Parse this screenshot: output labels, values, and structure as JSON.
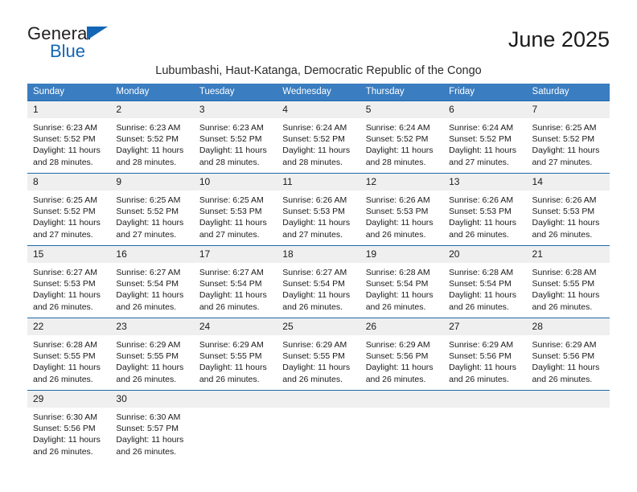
{
  "brand": {
    "name_top": "General",
    "name_bottom": "Blue",
    "accent_color": "#1266b5",
    "triangle_icon": "brand-triangle-icon"
  },
  "header": {
    "month_title": "June 2025",
    "subtitle": "Lubumbashi, Haut-Katanga, Democratic Republic of the Congo"
  },
  "calendar": {
    "header_bg": "#3a7dc0",
    "row_border": "#1f69ad",
    "daynum_bg": "#efefef",
    "weekdays": [
      "Sunday",
      "Monday",
      "Tuesday",
      "Wednesday",
      "Thursday",
      "Friday",
      "Saturday"
    ],
    "weeks": [
      [
        {
          "day": "1",
          "sunrise": "Sunrise: 6:23 AM",
          "sunset": "Sunset: 5:52 PM",
          "daylight_1": "Daylight: 11 hours",
          "daylight_2": "and 28 minutes."
        },
        {
          "day": "2",
          "sunrise": "Sunrise: 6:23 AM",
          "sunset": "Sunset: 5:52 PM",
          "daylight_1": "Daylight: 11 hours",
          "daylight_2": "and 28 minutes."
        },
        {
          "day": "3",
          "sunrise": "Sunrise: 6:23 AM",
          "sunset": "Sunset: 5:52 PM",
          "daylight_1": "Daylight: 11 hours",
          "daylight_2": "and 28 minutes."
        },
        {
          "day": "4",
          "sunrise": "Sunrise: 6:24 AM",
          "sunset": "Sunset: 5:52 PM",
          "daylight_1": "Daylight: 11 hours",
          "daylight_2": "and 28 minutes."
        },
        {
          "day": "5",
          "sunrise": "Sunrise: 6:24 AM",
          "sunset": "Sunset: 5:52 PM",
          "daylight_1": "Daylight: 11 hours",
          "daylight_2": "and 28 minutes."
        },
        {
          "day": "6",
          "sunrise": "Sunrise: 6:24 AM",
          "sunset": "Sunset: 5:52 PM",
          "daylight_1": "Daylight: 11 hours",
          "daylight_2": "and 27 minutes."
        },
        {
          "day": "7",
          "sunrise": "Sunrise: 6:25 AM",
          "sunset": "Sunset: 5:52 PM",
          "daylight_1": "Daylight: 11 hours",
          "daylight_2": "and 27 minutes."
        }
      ],
      [
        {
          "day": "8",
          "sunrise": "Sunrise: 6:25 AM",
          "sunset": "Sunset: 5:52 PM",
          "daylight_1": "Daylight: 11 hours",
          "daylight_2": "and 27 minutes."
        },
        {
          "day": "9",
          "sunrise": "Sunrise: 6:25 AM",
          "sunset": "Sunset: 5:52 PM",
          "daylight_1": "Daylight: 11 hours",
          "daylight_2": "and 27 minutes."
        },
        {
          "day": "10",
          "sunrise": "Sunrise: 6:25 AM",
          "sunset": "Sunset: 5:53 PM",
          "daylight_1": "Daylight: 11 hours",
          "daylight_2": "and 27 minutes."
        },
        {
          "day": "11",
          "sunrise": "Sunrise: 6:26 AM",
          "sunset": "Sunset: 5:53 PM",
          "daylight_1": "Daylight: 11 hours",
          "daylight_2": "and 27 minutes."
        },
        {
          "day": "12",
          "sunrise": "Sunrise: 6:26 AM",
          "sunset": "Sunset: 5:53 PM",
          "daylight_1": "Daylight: 11 hours",
          "daylight_2": "and 26 minutes."
        },
        {
          "day": "13",
          "sunrise": "Sunrise: 6:26 AM",
          "sunset": "Sunset: 5:53 PM",
          "daylight_1": "Daylight: 11 hours",
          "daylight_2": "and 26 minutes."
        },
        {
          "day": "14",
          "sunrise": "Sunrise: 6:26 AM",
          "sunset": "Sunset: 5:53 PM",
          "daylight_1": "Daylight: 11 hours",
          "daylight_2": "and 26 minutes."
        }
      ],
      [
        {
          "day": "15",
          "sunrise": "Sunrise: 6:27 AM",
          "sunset": "Sunset: 5:53 PM",
          "daylight_1": "Daylight: 11 hours",
          "daylight_2": "and 26 minutes."
        },
        {
          "day": "16",
          "sunrise": "Sunrise: 6:27 AM",
          "sunset": "Sunset: 5:54 PM",
          "daylight_1": "Daylight: 11 hours",
          "daylight_2": "and 26 minutes."
        },
        {
          "day": "17",
          "sunrise": "Sunrise: 6:27 AM",
          "sunset": "Sunset: 5:54 PM",
          "daylight_1": "Daylight: 11 hours",
          "daylight_2": "and 26 minutes."
        },
        {
          "day": "18",
          "sunrise": "Sunrise: 6:27 AM",
          "sunset": "Sunset: 5:54 PM",
          "daylight_1": "Daylight: 11 hours",
          "daylight_2": "and 26 minutes."
        },
        {
          "day": "19",
          "sunrise": "Sunrise: 6:28 AM",
          "sunset": "Sunset: 5:54 PM",
          "daylight_1": "Daylight: 11 hours",
          "daylight_2": "and 26 minutes."
        },
        {
          "day": "20",
          "sunrise": "Sunrise: 6:28 AM",
          "sunset": "Sunset: 5:54 PM",
          "daylight_1": "Daylight: 11 hours",
          "daylight_2": "and 26 minutes."
        },
        {
          "day": "21",
          "sunrise": "Sunrise: 6:28 AM",
          "sunset": "Sunset: 5:55 PM",
          "daylight_1": "Daylight: 11 hours",
          "daylight_2": "and 26 minutes."
        }
      ],
      [
        {
          "day": "22",
          "sunrise": "Sunrise: 6:28 AM",
          "sunset": "Sunset: 5:55 PM",
          "daylight_1": "Daylight: 11 hours",
          "daylight_2": "and 26 minutes."
        },
        {
          "day": "23",
          "sunrise": "Sunrise: 6:29 AM",
          "sunset": "Sunset: 5:55 PM",
          "daylight_1": "Daylight: 11 hours",
          "daylight_2": "and 26 minutes."
        },
        {
          "day": "24",
          "sunrise": "Sunrise: 6:29 AM",
          "sunset": "Sunset: 5:55 PM",
          "daylight_1": "Daylight: 11 hours",
          "daylight_2": "and 26 minutes."
        },
        {
          "day": "25",
          "sunrise": "Sunrise: 6:29 AM",
          "sunset": "Sunset: 5:55 PM",
          "daylight_1": "Daylight: 11 hours",
          "daylight_2": "and 26 minutes."
        },
        {
          "day": "26",
          "sunrise": "Sunrise: 6:29 AM",
          "sunset": "Sunset: 5:56 PM",
          "daylight_1": "Daylight: 11 hours",
          "daylight_2": "and 26 minutes."
        },
        {
          "day": "27",
          "sunrise": "Sunrise: 6:29 AM",
          "sunset": "Sunset: 5:56 PM",
          "daylight_1": "Daylight: 11 hours",
          "daylight_2": "and 26 minutes."
        },
        {
          "day": "28",
          "sunrise": "Sunrise: 6:29 AM",
          "sunset": "Sunset: 5:56 PM",
          "daylight_1": "Daylight: 11 hours",
          "daylight_2": "and 26 minutes."
        }
      ],
      [
        {
          "day": "29",
          "sunrise": "Sunrise: 6:30 AM",
          "sunset": "Sunset: 5:56 PM",
          "daylight_1": "Daylight: 11 hours",
          "daylight_2": "and 26 minutes."
        },
        {
          "day": "30",
          "sunrise": "Sunrise: 6:30 AM",
          "sunset": "Sunset: 5:57 PM",
          "daylight_1": "Daylight: 11 hours",
          "daylight_2": "and 26 minutes."
        },
        {
          "day": "",
          "sunrise": "",
          "sunset": "",
          "daylight_1": "",
          "daylight_2": ""
        },
        {
          "day": "",
          "sunrise": "",
          "sunset": "",
          "daylight_1": "",
          "daylight_2": ""
        },
        {
          "day": "",
          "sunrise": "",
          "sunset": "",
          "daylight_1": "",
          "daylight_2": ""
        },
        {
          "day": "",
          "sunrise": "",
          "sunset": "",
          "daylight_1": "",
          "daylight_2": ""
        },
        {
          "day": "",
          "sunrise": "",
          "sunset": "",
          "daylight_1": "",
          "daylight_2": ""
        }
      ]
    ]
  }
}
